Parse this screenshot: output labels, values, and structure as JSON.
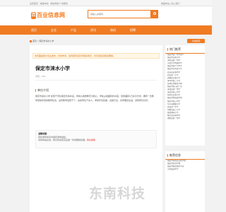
{
  "topbar": {
    "left": "设置首页 · 收藏本站 · 网站导航 广告服务",
    "right": "收藏本站 | 加入我们"
  },
  "logo": {
    "mark": "百",
    "text": "百业信息网"
  },
  "search": {
    "placeholder": "请输入关键词"
  },
  "nav": {
    "items": [
      "首页",
      "企业",
      "产品",
      "资讯",
      "商机",
      "招聘"
    ]
  },
  "breadcrumb": "首页 > 保定市涞水小学",
  "badge": "分类检索",
  "notice": "本页面由用户自主发布，仅供参考，如有疑问请及时联系我们，涉及侵权请联系删除。",
  "article": {
    "title": "保定市涞水小学",
    "meta": "浏览：106",
    "section_title": "单位介绍",
    "body": "保定市涞水小学 坐落于河北保定市涞水县，学校以素质教育为核心，学校占地面积约20亩，建筑面积1万余平方米，拥有一支教学经验丰富的教师队伍，设有教学班若干个，在校学生千余人。学校环境优美，设施齐全，办学理念先进，深受家长好评。"
  },
  "tip": {
    "title": "温馨提醒：",
    "line1": "若您发现本页内容有误或侵权，",
    "line2": "请向本站反馈，我们将在核实后第一时间删除处理。",
    "red": "联系邮箱"
  },
  "sidebar": {
    "hot_title": "热门推荐",
    "hot_items": [
      "保定市第一中学简介",
      "保定市实验小学",
      "涞水县第一中学",
      "河北大学附属中学",
      "保定市第十七中学",
      "保定市竞秀区小学",
      "定兴县实验中学",
      "易县第一小学",
      "满城区实验小学",
      "涿州市第二小学",
      "高碑店市职业学校",
      "保定市幼儿园一览",
      "涞源县第一中学",
      "清苑区第三中学",
      "徐水区实验小学",
      "保定市外国语学校",
      "保定市第三中学",
      "阜平县城厢小学",
      "唐县第一中学",
      "望都县第二小学",
      "蠡县城关小学",
      "顺平县实验中学",
      "博野县第一中学"
    ],
    "rec_title": "推荐信息",
    "rec_items": [
      "保定市涞水县实验学校",
      "保定市培训学校",
      "保定市职业技术学院",
      "河北保定中学"
    ]
  },
  "ghost": "东南科技"
}
